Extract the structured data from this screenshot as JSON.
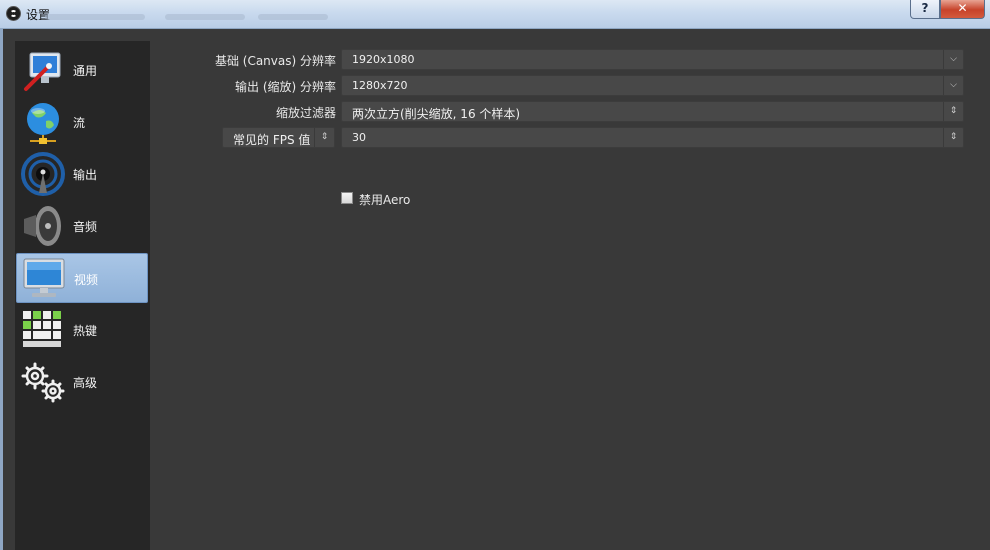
{
  "window": {
    "title": "设置",
    "help_label": "?",
    "close_label": "✕"
  },
  "sidebar": {
    "items": [
      {
        "label": "通用",
        "icon": "monitor-wand-icon",
        "selected": false
      },
      {
        "label": "流",
        "icon": "globe-network-icon",
        "selected": false
      },
      {
        "label": "输出",
        "icon": "broadcast-dish-icon",
        "selected": false
      },
      {
        "label": "音频",
        "icon": "speaker-icon",
        "selected": false
      },
      {
        "label": "视频",
        "icon": "display-monitor-icon",
        "selected": true
      },
      {
        "label": "热键",
        "icon": "keyboard-icon",
        "selected": false
      },
      {
        "label": "高级",
        "icon": "gears-icon",
        "selected": false
      }
    ]
  },
  "video": {
    "base_resolution": {
      "label": "基础 (Canvas) 分辨率",
      "value": "1920x1080"
    },
    "output_resolution": {
      "label": "输出 (缩放) 分辨率",
      "value": "1280x720"
    },
    "downscale_filter": {
      "label": "缩放过滤器",
      "value": "两次立方(削尖缩放, 16 个样本)"
    },
    "fps_type": {
      "value": "常见的 FPS 值"
    },
    "fps_value": {
      "value": "30"
    },
    "disable_aero": {
      "label": "禁用Aero",
      "checked": false
    }
  },
  "colors": {
    "background": "#393939",
    "sidebar": "#262626",
    "selected_item": "#9dbde0",
    "field": "#484848"
  }
}
